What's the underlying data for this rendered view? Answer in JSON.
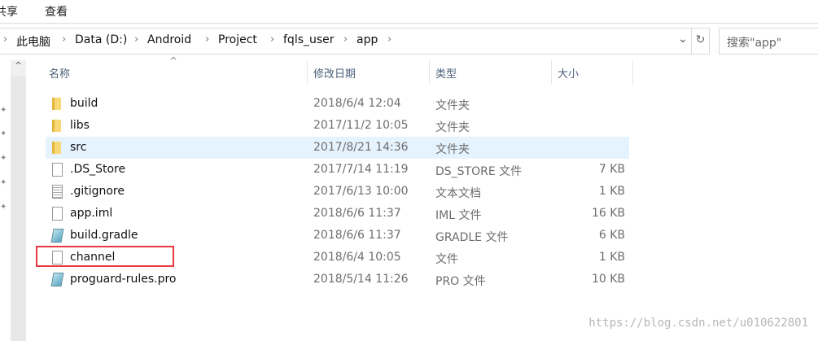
{
  "menu": [
    "共享",
    "查看"
  ],
  "breadcrumb": [
    "此电脑",
    "Data (D:)",
    "Android",
    "Project",
    "fqls_user",
    "app"
  ],
  "search": {
    "placeholder": "搜索\"app\""
  },
  "headers": {
    "name": "名称",
    "date": "修改日期",
    "type": "类型",
    "size": "大小"
  },
  "files": [
    {
      "name": "build",
      "date": "2018/6/4 12:04",
      "type": "文件夹",
      "size": "",
      "icon": "folder"
    },
    {
      "name": "libs",
      "date": "2017/11/2 10:05",
      "type": "文件夹",
      "size": "",
      "icon": "folder"
    },
    {
      "name": "src",
      "date": "2017/8/21 14:36",
      "type": "文件夹",
      "size": "",
      "icon": "folder",
      "selected": true
    },
    {
      "name": ".DS_Store",
      "date": "2017/7/14 11:19",
      "type": "DS_STORE 文件",
      "size": "7 KB",
      "icon": "file"
    },
    {
      "name": ".gitignore",
      "date": "2017/6/13 10:00",
      "type": "文本文档",
      "size": "1 KB",
      "icon": "text"
    },
    {
      "name": "app.iml",
      "date": "2018/6/6 11:37",
      "type": "IML 文件",
      "size": "16 KB",
      "icon": "file"
    },
    {
      "name": "build.gradle",
      "date": "2018/6/6 11:37",
      "type": "GRADLE 文件",
      "size": "6 KB",
      "icon": "gradle"
    },
    {
      "name": "channel",
      "date": "2018/6/4 10:05",
      "type": "文件",
      "size": "1 KB",
      "icon": "file"
    },
    {
      "name": "proguard-rules.pro",
      "date": "2018/5/14 11:26",
      "type": "PRO 文件",
      "size": "10 KB",
      "icon": "gradle"
    }
  ],
  "watermark": "https://blog.csdn.net/u010622801",
  "colors": {
    "selected": "#e5f3ff",
    "highlight_box": "#e8383d"
  }
}
